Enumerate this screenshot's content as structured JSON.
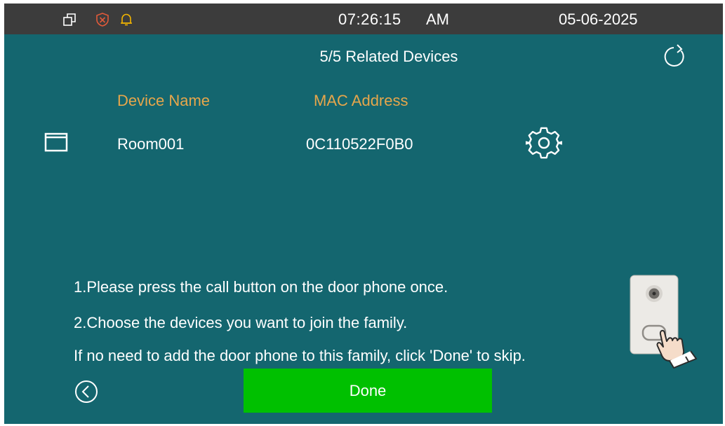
{
  "status_bar": {
    "time": "07:26:15",
    "ampm": "AM",
    "date": "05-06-2025",
    "icons": [
      "windows-icon",
      "shield-icon",
      "bell-icon"
    ]
  },
  "header": {
    "title": "5/5 Related Devices",
    "refresh_icon": "refresh-icon"
  },
  "table": {
    "columns": {
      "device_name": "Device Name",
      "mac_address": "MAC Address"
    },
    "rows": [
      {
        "device_name": "Room001",
        "mac_address": "0C110522F0B0",
        "row_icon": "window-icon",
        "settings_icon": "gear-icon"
      }
    ]
  },
  "instructions": {
    "step1": "1.Please press the call button on the door phone once.",
    "step2": "2.Choose the devices you want to join the family.",
    "skip_note": "If no need to add the door phone to this family, click 'Done' to skip."
  },
  "footer": {
    "done_label": "Done",
    "back_icon": "back-icon"
  },
  "colors": {
    "background": "#14666f",
    "status_bar": "#3c3c3c",
    "header_text": "#e6a64b",
    "done_button": "#00c000",
    "shield_icon": "#e05a3a",
    "bell_icon": "#f2b500"
  }
}
